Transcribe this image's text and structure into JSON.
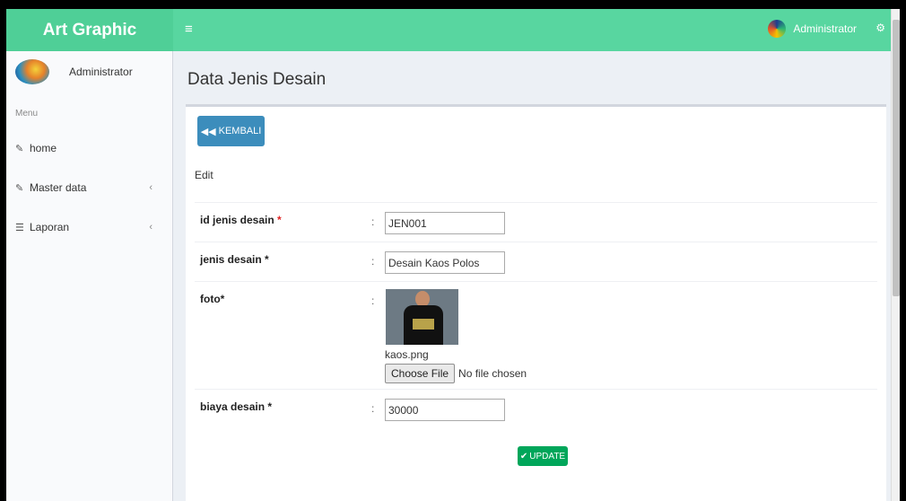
{
  "header": {
    "brand": "Art Graphic",
    "menu_icon": "hamburger-icon",
    "user_name": "Administrator",
    "settings_icon": "gears-icon"
  },
  "sidebar": {
    "user_name": "Administrator",
    "menu_header": "Menu",
    "items": [
      {
        "label": "home",
        "icon": "edit-icon"
      },
      {
        "label": "Master data",
        "icon": "edit-icon"
      },
      {
        "label": "Laporan",
        "icon": "sitemap-icon"
      }
    ]
  },
  "page": {
    "title": "Data Jenis Desain",
    "back_button": "KEMBALI",
    "box_title": "Edit",
    "update_button": "UPDATE"
  },
  "form": {
    "id_label": "id jenis desain",
    "id_value": "JEN001",
    "jenis_label": "jenis desain",
    "jenis_value": "Desain Kaos Polos",
    "foto_label": "foto",
    "foto_filename": "kaos.png",
    "file_button": "Choose File",
    "file_status": "No file chosen",
    "biaya_label": "biaya desain",
    "biaya_value": "30000",
    "colon": ":",
    "required_mark": "*"
  },
  "colors": {
    "header": "#58d6a0",
    "primary": "#3c8dbc",
    "success": "#00a65a",
    "required": "#e02424"
  }
}
